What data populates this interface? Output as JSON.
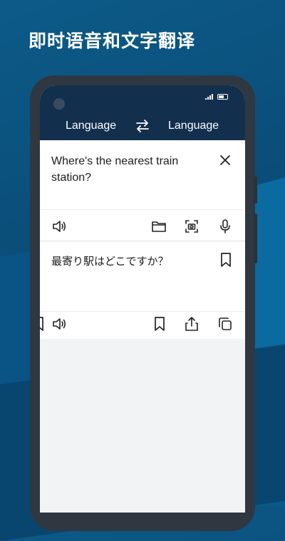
{
  "headline": "即时语音和文字翻译",
  "app": {
    "source_language": "Language",
    "target_language": "Language",
    "source_text": "Where's the nearest train station?",
    "translated_text": "最寄り駅はどこですか？"
  },
  "colors": {
    "appbar": "#132f4e",
    "background": "#0a4d78",
    "card": "#ffffff"
  },
  "icons": [
    "swap-icon",
    "close-icon",
    "speaker-icon",
    "folder-icon",
    "camera-icon",
    "microphone-icon",
    "bookmark-icon",
    "share-icon",
    "copy-icon"
  ]
}
